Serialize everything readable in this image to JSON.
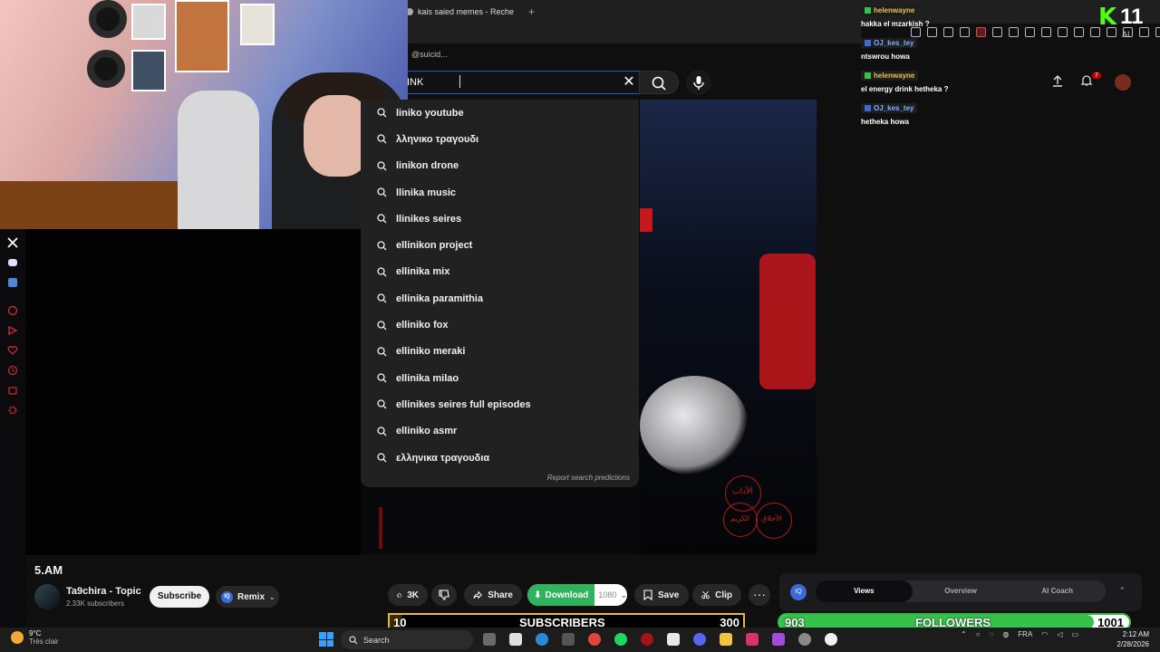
{
  "browser": {
    "tab_title": "kais saied memes - Reche",
    "new_tab": "+",
    "bookmark": "@suicid..."
  },
  "ai_button": "AI",
  "search": {
    "query": "INK",
    "clear": "✕",
    "suggestions": [
      "liniko youtube",
      "λληνικο τραγουδι",
      "linikon drone",
      "llinika music",
      "llinikes seires",
      "ellinikon project",
      "ellinika mix",
      "ellinika paramithia",
      "elliniko fox",
      "elliniko meraki",
      "ellinika milao",
      "ellinikes seires full episodes",
      "elliniko asmr",
      "ελληνικα τραγουδια"
    ],
    "report": "Report search predictions"
  },
  "notifications_count": "7",
  "video": {
    "title": "5.AM",
    "channel": "Ta9chira - Topic",
    "subscribers": "2.33K subscribers",
    "subscribe_label": "Subscribe",
    "remix_label": "Remix",
    "like_count": "3K",
    "share_label": "Share",
    "download_label": "Download",
    "download_quality": "1080",
    "save_label": "Save",
    "clip_label": "Clip",
    "more": "···"
  },
  "stats_panel": {
    "badge": "IQ",
    "tabs": [
      "Views",
      "Overview",
      "AI Coach"
    ],
    "active_tab": "Views"
  },
  "goals": {
    "subscribers": {
      "current": "10",
      "label": "SUBSCRIBERS",
      "target": "300",
      "progress": 0.033
    },
    "followers": {
      "current": "903",
      "label": "FOLLOWERS",
      "target": "1001",
      "progress": 0.9
    }
  },
  "chat": [
    {
      "user": "helenwayne",
      "text": "hakka el mzarkish ?",
      "badge": "green"
    },
    {
      "user": "OJ_kes_tey",
      "text": "ntswrou howa",
      "badge": "blue"
    },
    {
      "user": "helenwayne",
      "text": "el energy drink hetheka ?",
      "badge": "green"
    },
    {
      "user": "OJ_kes_tey",
      "text": "hetheka howa",
      "badge": "blue"
    }
  ],
  "kick": {
    "logo": "K",
    "viewers": "11"
  },
  "seal_text": [
    "الآداب",
    "الأخلاق",
    "الكريم"
  ],
  "taskbar": {
    "temp": "9°C",
    "weather": "Très clair",
    "search": "Search",
    "lang": "FRA",
    "time": "2:12 AM",
    "date": "2/28/2026"
  },
  "colors": {
    "accent_blue": "#1c62b9",
    "download_green": "#2fb35c",
    "kick_green": "#53fc18",
    "goal_gold": "#e8b73e",
    "goal_green": "#35c24a"
  }
}
